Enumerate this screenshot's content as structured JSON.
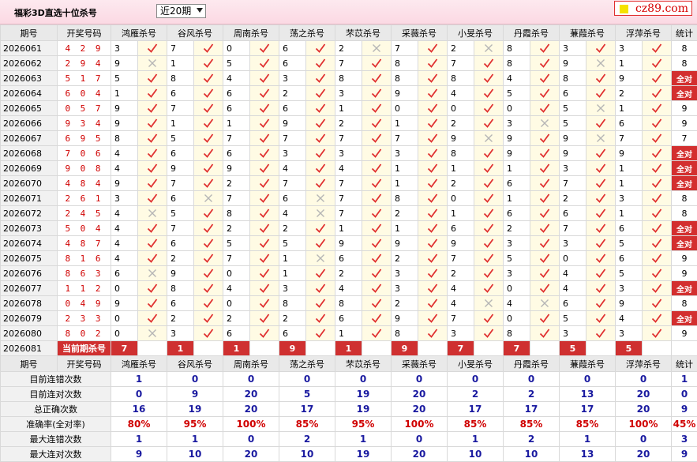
{
  "header": {
    "title": "福彩3D直选十位杀号",
    "period_select": "近20期",
    "logo": "cz89.com"
  },
  "columns": {
    "issue": "期号",
    "draw": "开奖号码",
    "experts": [
      "鸿雁杀号",
      "谷风杀号",
      "周南杀号",
      "荡之杀号",
      "芣苡杀号",
      "采薇杀号",
      "小旻杀号",
      "丹霞杀号",
      "蒹葭杀号",
      "浮萍杀号"
    ],
    "stat": "统计"
  },
  "rows": [
    {
      "issue": "2026061",
      "draw": "429",
      "kills": [
        [
          "3",
          1
        ],
        [
          "7",
          1
        ],
        [
          "0",
          1
        ],
        [
          "6",
          1
        ],
        [
          "2",
          0
        ],
        [
          "7",
          1
        ],
        [
          "2",
          0
        ],
        [
          "8",
          1
        ],
        [
          "3",
          1
        ],
        [
          "3",
          1
        ]
      ],
      "stat": "8"
    },
    {
      "issue": "2026062",
      "draw": "294",
      "kills": [
        [
          "9",
          0
        ],
        [
          "1",
          1
        ],
        [
          "5",
          1
        ],
        [
          "6",
          1
        ],
        [
          "7",
          1
        ],
        [
          "8",
          1
        ],
        [
          "7",
          1
        ],
        [
          "8",
          1
        ],
        [
          "9",
          0
        ],
        [
          "1",
          1
        ]
      ],
      "stat": "8"
    },
    {
      "issue": "2026063",
      "draw": "517",
      "kills": [
        [
          "5",
          1
        ],
        [
          "8",
          1
        ],
        [
          "4",
          1
        ],
        [
          "3",
          1
        ],
        [
          "8",
          1
        ],
        [
          "8",
          1
        ],
        [
          "8",
          1
        ],
        [
          "4",
          1
        ],
        [
          "8",
          1
        ],
        [
          "9",
          1
        ]
      ],
      "stat": "全对"
    },
    {
      "issue": "2026064",
      "draw": "604",
      "kills": [
        [
          "1",
          1
        ],
        [
          "6",
          1
        ],
        [
          "6",
          1
        ],
        [
          "2",
          1
        ],
        [
          "3",
          1
        ],
        [
          "9",
          1
        ],
        [
          "4",
          1
        ],
        [
          "5",
          1
        ],
        [
          "6",
          1
        ],
        [
          "2",
          1
        ]
      ],
      "stat": "全对"
    },
    {
      "issue": "2026065",
      "draw": "057",
      "kills": [
        [
          "9",
          1
        ],
        [
          "7",
          1
        ],
        [
          "6",
          1
        ],
        [
          "6",
          1
        ],
        [
          "1",
          1
        ],
        [
          "0",
          1
        ],
        [
          "0",
          1
        ],
        [
          "0",
          1
        ],
        [
          "5",
          0
        ],
        [
          "1",
          1
        ]
      ],
      "stat": "9"
    },
    {
      "issue": "2026066",
      "draw": "934",
      "kills": [
        [
          "9",
          1
        ],
        [
          "1",
          1
        ],
        [
          "1",
          1
        ],
        [
          "9",
          1
        ],
        [
          "2",
          1
        ],
        [
          "1",
          1
        ],
        [
          "2",
          1
        ],
        [
          "3",
          0
        ],
        [
          "5",
          1
        ],
        [
          "6",
          1
        ]
      ],
      "stat": "9"
    },
    {
      "issue": "2026067",
      "draw": "695",
      "kills": [
        [
          "8",
          1
        ],
        [
          "5",
          1
        ],
        [
          "7",
          1
        ],
        [
          "7",
          1
        ],
        [
          "7",
          1
        ],
        [
          "7",
          1
        ],
        [
          "9",
          0
        ],
        [
          "9",
          1
        ],
        [
          "9",
          0
        ],
        [
          "7",
          1
        ]
      ],
      "stat": "7"
    },
    {
      "issue": "2026068",
      "draw": "706",
      "kills": [
        [
          "4",
          1
        ],
        [
          "6",
          1
        ],
        [
          "6",
          1
        ],
        [
          "3",
          1
        ],
        [
          "3",
          1
        ],
        [
          "3",
          1
        ],
        [
          "8",
          1
        ],
        [
          "9",
          1
        ],
        [
          "9",
          1
        ],
        [
          "9",
          1
        ]
      ],
      "stat": "全对"
    },
    {
      "issue": "2026069",
      "draw": "908",
      "kills": [
        [
          "4",
          1
        ],
        [
          "9",
          1
        ],
        [
          "9",
          1
        ],
        [
          "4",
          1
        ],
        [
          "4",
          1
        ],
        [
          "1",
          1
        ],
        [
          "1",
          1
        ],
        [
          "1",
          1
        ],
        [
          "3",
          1
        ],
        [
          "1",
          1
        ]
      ],
      "stat": "全对"
    },
    {
      "issue": "2026070",
      "draw": "484",
      "kills": [
        [
          "9",
          1
        ],
        [
          "7",
          1
        ],
        [
          "2",
          1
        ],
        [
          "7",
          1
        ],
        [
          "7",
          1
        ],
        [
          "1",
          1
        ],
        [
          "2",
          1
        ],
        [
          "6",
          1
        ],
        [
          "7",
          1
        ],
        [
          "1",
          1
        ]
      ],
      "stat": "全对"
    },
    {
      "issue": "2026071",
      "draw": "261",
      "kills": [
        [
          "3",
          1
        ],
        [
          "6",
          0
        ],
        [
          "7",
          1
        ],
        [
          "6",
          0
        ],
        [
          "7",
          1
        ],
        [
          "8",
          1
        ],
        [
          "0",
          1
        ],
        [
          "1",
          1
        ],
        [
          "2",
          1
        ],
        [
          "3",
          1
        ]
      ],
      "stat": "8"
    },
    {
      "issue": "2026072",
      "draw": "245",
      "kills": [
        [
          "4",
          0
        ],
        [
          "5",
          1
        ],
        [
          "8",
          1
        ],
        [
          "4",
          0
        ],
        [
          "7",
          1
        ],
        [
          "2",
          1
        ],
        [
          "1",
          1
        ],
        [
          "6",
          1
        ],
        [
          "6",
          1
        ],
        [
          "1",
          1
        ]
      ],
      "stat": "8"
    },
    {
      "issue": "2026073",
      "draw": "504",
      "kills": [
        [
          "4",
          1
        ],
        [
          "7",
          1
        ],
        [
          "2",
          1
        ],
        [
          "2",
          1
        ],
        [
          "1",
          1
        ],
        [
          "1",
          1
        ],
        [
          "6",
          1
        ],
        [
          "2",
          1
        ],
        [
          "7",
          1
        ],
        [
          "6",
          1
        ]
      ],
      "stat": "全对"
    },
    {
      "issue": "2026074",
      "draw": "487",
      "kills": [
        [
          "4",
          1
        ],
        [
          "6",
          1
        ],
        [
          "5",
          1
        ],
        [
          "5",
          1
        ],
        [
          "9",
          1
        ],
        [
          "9",
          1
        ],
        [
          "9",
          1
        ],
        [
          "3",
          1
        ],
        [
          "3",
          1
        ],
        [
          "5",
          1
        ]
      ],
      "stat": "全对"
    },
    {
      "issue": "2026075",
      "draw": "816",
      "kills": [
        [
          "4",
          1
        ],
        [
          "2",
          1
        ],
        [
          "7",
          1
        ],
        [
          "1",
          0
        ],
        [
          "6",
          1
        ],
        [
          "2",
          1
        ],
        [
          "7",
          1
        ],
        [
          "5",
          1
        ],
        [
          "0",
          1
        ],
        [
          "6",
          1
        ]
      ],
      "stat": "9"
    },
    {
      "issue": "2026076",
      "draw": "863",
      "kills": [
        [
          "6",
          0
        ],
        [
          "9",
          1
        ],
        [
          "0",
          1
        ],
        [
          "1",
          1
        ],
        [
          "2",
          1
        ],
        [
          "3",
          1
        ],
        [
          "2",
          1
        ],
        [
          "3",
          1
        ],
        [
          "4",
          1
        ],
        [
          "5",
          1
        ]
      ],
      "stat": "9"
    },
    {
      "issue": "2026077",
      "draw": "112",
      "kills": [
        [
          "0",
          1
        ],
        [
          "8",
          1
        ],
        [
          "4",
          1
        ],
        [
          "3",
          1
        ],
        [
          "4",
          1
        ],
        [
          "3",
          1
        ],
        [
          "4",
          1
        ],
        [
          "0",
          1
        ],
        [
          "4",
          1
        ],
        [
          "3",
          1
        ]
      ],
      "stat": "全对"
    },
    {
      "issue": "2026078",
      "draw": "049",
      "kills": [
        [
          "9",
          1
        ],
        [
          "6",
          1
        ],
        [
          "0",
          1
        ],
        [
          "8",
          1
        ],
        [
          "8",
          1
        ],
        [
          "2",
          1
        ],
        [
          "4",
          0
        ],
        [
          "4",
          0
        ],
        [
          "6",
          1
        ],
        [
          "9",
          1
        ]
      ],
      "stat": "8"
    },
    {
      "issue": "2026079",
      "draw": "233",
      "kills": [
        [
          "0",
          1
        ],
        [
          "2",
          1
        ],
        [
          "2",
          1
        ],
        [
          "2",
          1
        ],
        [
          "6",
          1
        ],
        [
          "9",
          1
        ],
        [
          "7",
          1
        ],
        [
          "0",
          1
        ],
        [
          "5",
          1
        ],
        [
          "4",
          1
        ]
      ],
      "stat": "全对"
    },
    {
      "issue": "2026080",
      "draw": "802",
      "kills": [
        [
          "0",
          0
        ],
        [
          "3",
          1
        ],
        [
          "6",
          1
        ],
        [
          "6",
          1
        ],
        [
          "1",
          1
        ],
        [
          "8",
          1
        ],
        [
          "3",
          1
        ],
        [
          "8",
          1
        ],
        [
          "3",
          1
        ],
        [
          "3",
          1
        ]
      ],
      "stat": "9"
    }
  ],
  "current": {
    "issue": "2026081",
    "label": "当前期杀号",
    "kills": [
      "7",
      "1",
      "1",
      "9",
      "1",
      "9",
      "7",
      "7",
      "5",
      "5"
    ]
  },
  "summary": [
    {
      "label": "目前连错次数",
      "values": [
        "1",
        "0",
        "0",
        "0",
        "0",
        "0",
        "0",
        "0",
        "0",
        "0"
      ],
      "stat": "1",
      "red": false
    },
    {
      "label": "目前连对次数",
      "values": [
        "0",
        "9",
        "20",
        "5",
        "19",
        "20",
        "2",
        "2",
        "13",
        "20"
      ],
      "stat": "0",
      "red": false
    },
    {
      "label": "总正确次数",
      "values": [
        "16",
        "19",
        "20",
        "17",
        "19",
        "20",
        "17",
        "17",
        "17",
        "20"
      ],
      "stat": "9",
      "red": false
    },
    {
      "label": "准确率(全对率)",
      "values": [
        "80%",
        "95%",
        "100%",
        "85%",
        "95%",
        "100%",
        "85%",
        "85%",
        "85%",
        "100%"
      ],
      "stat": "45%",
      "red": true
    },
    {
      "label": "最大连错次数",
      "values": [
        "1",
        "1",
        "0",
        "2",
        "1",
        "0",
        "1",
        "2",
        "1",
        "0"
      ],
      "stat": "3",
      "red": false
    },
    {
      "label": "最大连对次数",
      "values": [
        "9",
        "10",
        "20",
        "10",
        "19",
        "20",
        "10",
        "10",
        "13",
        "20"
      ],
      "stat": "9",
      "red": false
    }
  ],
  "icons": {
    "correct": "check-icon",
    "wrong": "cross-icon"
  },
  "colors": {
    "check": "#e03030",
    "cross": "#b5b5b5",
    "accent": "#d32f2f",
    "summary": "#1a1aa0"
  }
}
